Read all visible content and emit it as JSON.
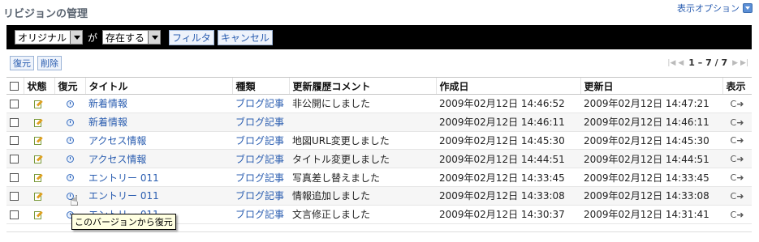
{
  "header": {
    "title": "リビジョンの管理",
    "display_options": "表示オプション"
  },
  "filter": {
    "field_select": "オリジナル",
    "connector": "が",
    "condition_select": "存在する",
    "filter_button": "フィルタ",
    "cancel_button": "キャンセル"
  },
  "actions": {
    "restore_button": "復元",
    "delete_button": "削除"
  },
  "pager": {
    "range": "1 – 7 / 7"
  },
  "table": {
    "columns": [
      "状態",
      "復元",
      "タイトル",
      "種類",
      "更新履歴コメント",
      "作成日",
      "更新日",
      "表示"
    ],
    "rows": [
      {
        "title": "新着情報",
        "type": "ブログ記事",
        "comment": "非公開にしました",
        "created": "2009年02月12日  14:46:52",
        "updated": "2009年02月12日  14:47:21"
      },
      {
        "title": "新着情報",
        "type": "ブログ記事",
        "comment": "",
        "created": "2009年02月12日  14:46:11",
        "updated": "2009年02月12日  14:46:11"
      },
      {
        "title": "アクセス情報",
        "type": "ブログ記事",
        "comment": "地図URL変更しました",
        "created": "2009年02月12日  14:45:30",
        "updated": "2009年02月12日  14:45:30"
      },
      {
        "title": "アクセス情報",
        "type": "ブログ記事",
        "comment": "タイトル変更しました",
        "created": "2009年02月12日  14:44:51",
        "updated": "2009年02月12日  14:44:51"
      },
      {
        "title": "エントリー 011",
        "type": "ブログ記事",
        "comment": "写真差し替えました",
        "created": "2009年02月12日  14:33:45",
        "updated": "2009年02月12日  14:33:45"
      },
      {
        "title": "エントリー 011",
        "type": "ブログ記事",
        "comment": "情報追加しました",
        "created": "2009年02月12日  14:33:08",
        "updated": "2009年02月12日  14:33:08"
      },
      {
        "title": "エントリー 011",
        "type": "ブログ記事",
        "comment": "文言修正しました",
        "created": "2009年02月12日  14:30:37",
        "updated": "2009年02月12日  14:31:41"
      }
    ]
  },
  "tooltip": {
    "text": "このバージョンから復元"
  },
  "icons": {
    "status": "edit-icon",
    "restore": "clock-icon",
    "view": "view-arrow-icon"
  }
}
